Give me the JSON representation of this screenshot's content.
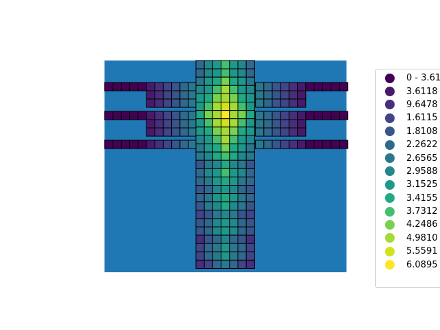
{
  "chart_data": {
    "type": "heatmap",
    "title": "",
    "xlabel": "",
    "ylabel": "",
    "axes_visible": false,
    "background_color": "#1f77b4",
    "cell_edge_color": "#000000",
    "colormap": "viridis",
    "grid": {
      "rows": 25,
      "cols": 29,
      "cells": [
        "......................",
        "........0000000000000.",
        "...0000000000000000000",
        "..."
      ]
    },
    "legend": {
      "position": "right",
      "entries": [
        {
          "label": "0 - 3.61",
          "color": "#440154"
        },
        {
          "label": "3.6118",
          "color": "#481a6c"
        },
        {
          "label": "9.6478",
          "color": "#472f7d"
        },
        {
          "label": "1.6115",
          "color": "#414487"
        },
        {
          "label": "1.8108",
          "color": "#39568c"
        },
        {
          "label": "2.2622",
          "color": "#31688e"
        },
        {
          "label": "2.6565",
          "color": "#2a788e"
        },
        {
          "label": "2.9588",
          "color": "#23888e"
        },
        {
          "label": "3.1525",
          "color": "#1f988b"
        },
        {
          "label": "3.4155",
          "color": "#22a884"
        },
        {
          "label": "3.7312",
          "color": "#44bf70"
        },
        {
          "label": "4.2486",
          "color": "#7ad151"
        },
        {
          "label": "4.9810",
          "color": "#a5db36"
        },
        {
          "label": "5.5591",
          "color": "#d2e21b"
        },
        {
          "label": "6.0895",
          "color": "#fde725"
        }
      ]
    }
  }
}
